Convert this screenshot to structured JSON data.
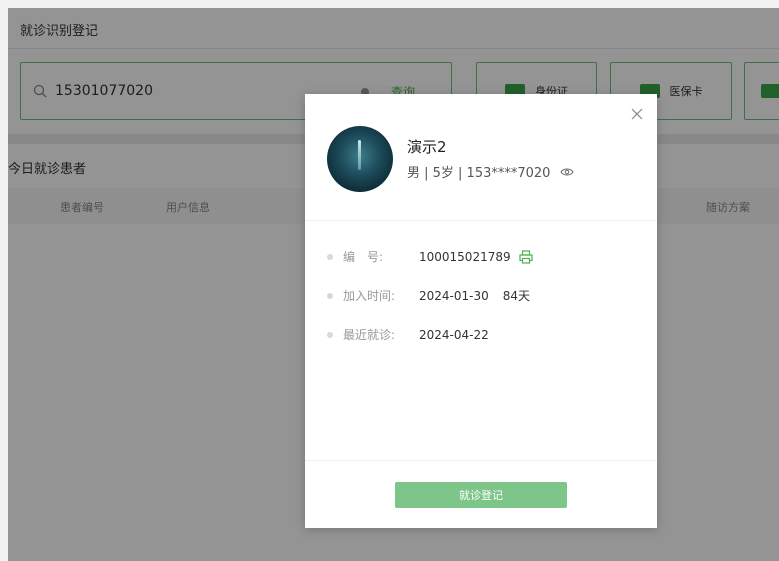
{
  "page": {
    "section_title": "就诊识别登记",
    "search": {
      "value": "15301077020",
      "query_label": "查询"
    },
    "buttons": {
      "id_card": "身份证",
      "medical_card": "医保卡"
    },
    "today_title": "今日就诊患者",
    "table_headers": {
      "patient_id": "患者编号",
      "user_info": "用户信息",
      "plan": "随访方案"
    }
  },
  "modal": {
    "name": "演示2",
    "meta": "男 | 5岁 | 153****7020",
    "rows": [
      {
        "label": "编　号:",
        "value": "100015021789"
      },
      {
        "label": "加入时间:",
        "value": "2024-01-30",
        "extra": "84天"
      },
      {
        "label": "最近就诊:",
        "value": "2024-04-22"
      }
    ],
    "button_label": "就诊登记"
  },
  "colors": {
    "accent": "#4caf50",
    "button": "#7ec58a",
    "border": "#6cbf7b"
  },
  "icons": [
    "search-icon",
    "close-icon",
    "eye-icon",
    "printer-icon",
    "card-icon"
  ]
}
